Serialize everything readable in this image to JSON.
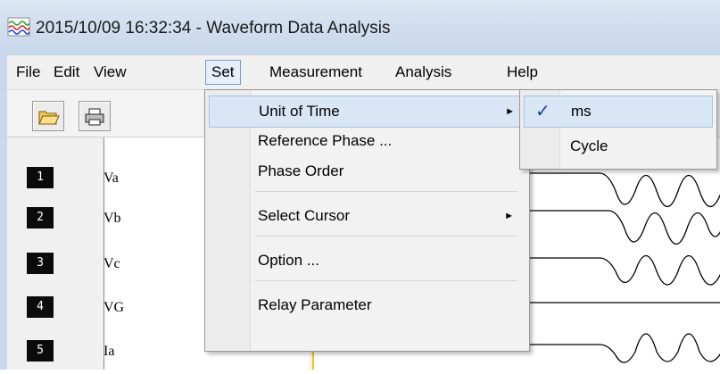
{
  "window": {
    "title": "2015/10/09 16:32:34  - Waveform Data Analysis",
    "icon": "waveform-app-icon"
  },
  "menubar": {
    "items": [
      "File",
      "Edit",
      "View",
      "Set",
      "Measurement",
      "Analysis",
      "Help"
    ],
    "active": "Set"
  },
  "toolbar": {
    "buttons": [
      "open-folder-icon",
      "print-icon"
    ]
  },
  "channels": [
    {
      "num": "1",
      "name": "Va"
    },
    {
      "num": "2",
      "name": "Vb"
    },
    {
      "num": "3",
      "name": "Vc"
    },
    {
      "num": "4",
      "name": "VG"
    },
    {
      "num": "5",
      "name": "Ia"
    }
  ],
  "set_menu": {
    "items": [
      {
        "label": "Unit of Time",
        "submenu": "►"
      },
      {
        "label": "Reference Phase ..."
      },
      {
        "label": "Phase Order"
      },
      {
        "label": "Select Cursor",
        "submenu": "►"
      },
      {
        "label": "Option ..."
      },
      {
        "label": "Relay Parameter"
      }
    ]
  },
  "unit_submenu": {
    "items": [
      {
        "label": "ms",
        "check": "✓"
      },
      {
        "label": "Cycle"
      }
    ]
  },
  "colors": {
    "accent": "#7d9ac4",
    "highlight": "#d9e6f5",
    "cursor_line": "#f4c400"
  }
}
